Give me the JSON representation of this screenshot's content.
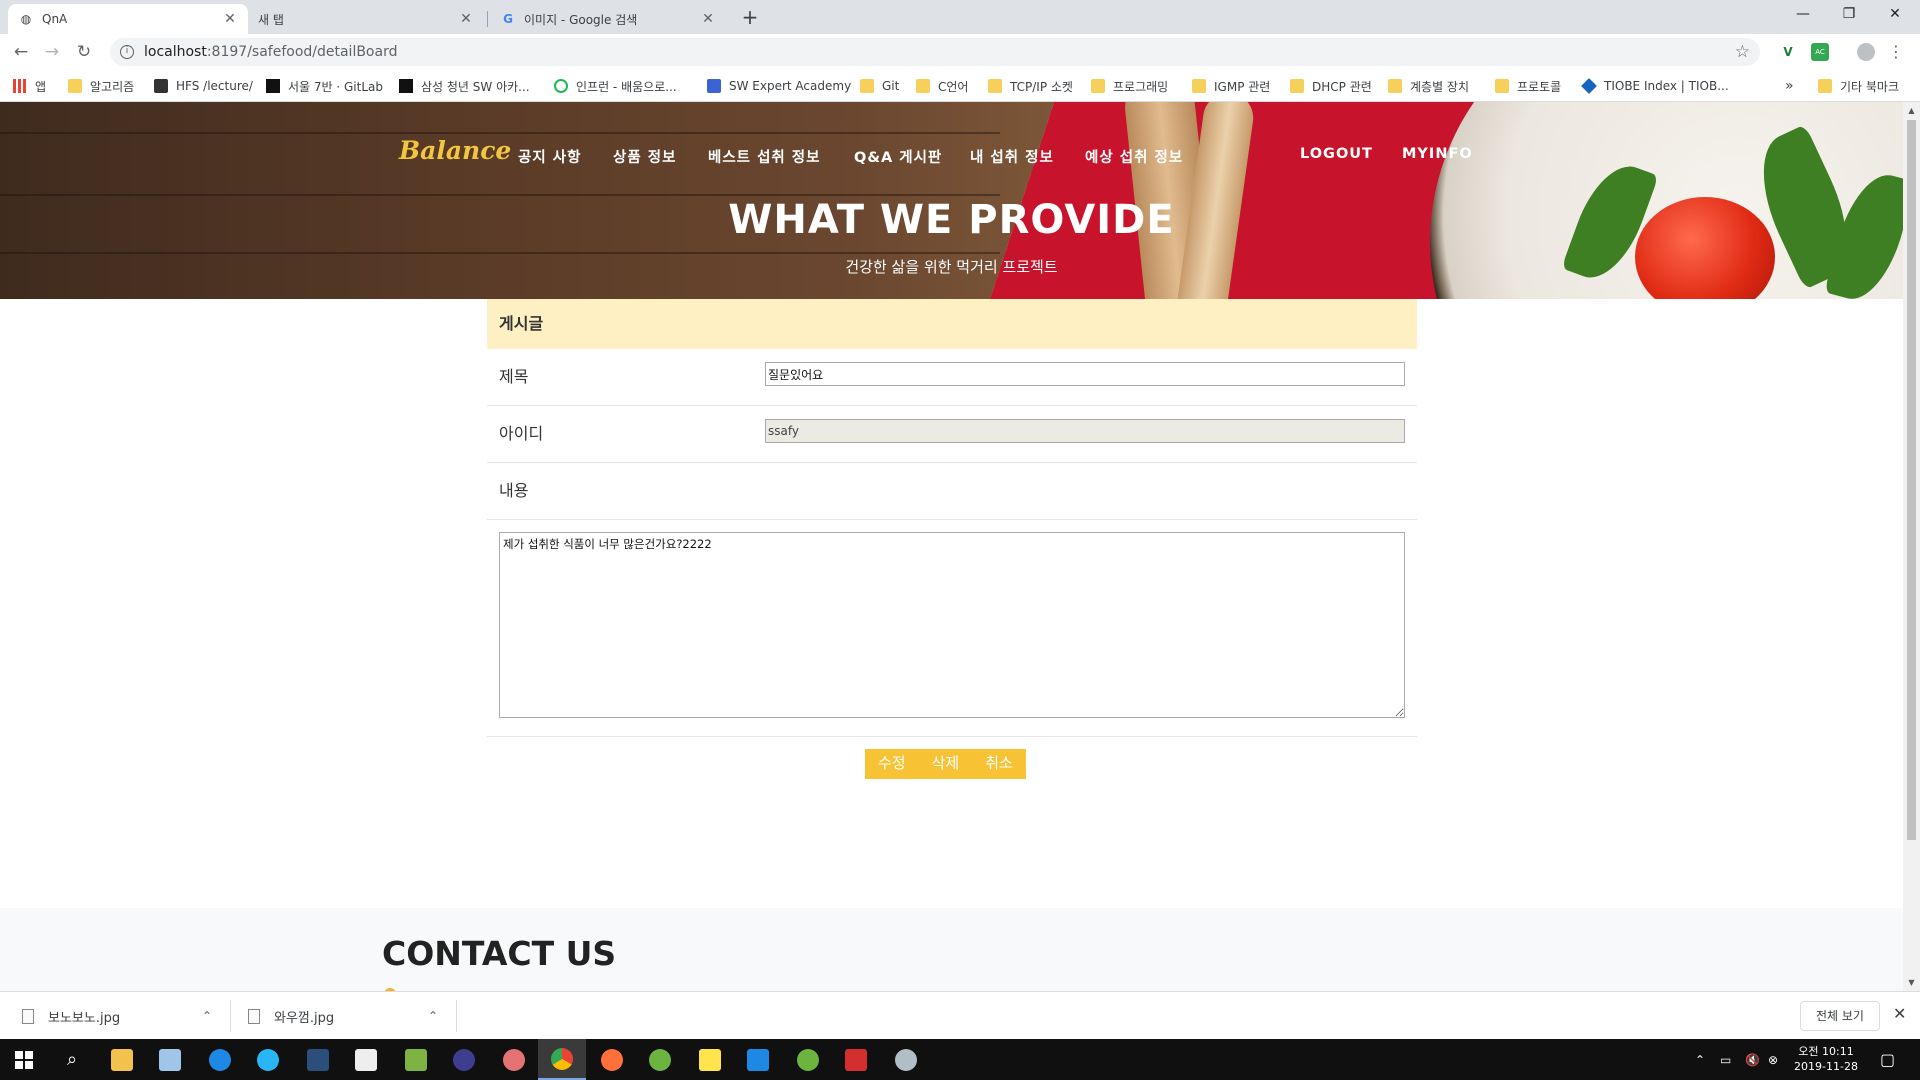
{
  "browser": {
    "tabs": [
      {
        "title": "QnA",
        "active": true
      },
      {
        "title": "새 탭",
        "active": false
      },
      {
        "title": "이미지 - Google 검색",
        "active": false
      }
    ],
    "url_host": "localhost",
    "url_path": ":8197/safefood/detailBoard",
    "bookmarks": [
      "앱",
      "알고리즘",
      "HFS /lecture/",
      "서울 7반 · GitLab",
      "삼성 청년 SW 아카...",
      "인프런 - 배움으로...",
      "SW Expert Academy",
      "Git",
      "C언어",
      "TCP/IP 소켓",
      "프로그래밍",
      "IGMP 관련",
      "DHCP 관련",
      "계층별 장치",
      "프로토콜",
      "TIOBE Index | TIOB..."
    ],
    "bookmarks_more": "»",
    "other_bookmarks": "기타 북마크"
  },
  "site": {
    "brand": "Balance",
    "nav": [
      "공지 사항",
      "상품 정보",
      "베스트 섭취 정보",
      "Q&A 게시판",
      "내 섭취 정보",
      "예상 섭취 정보",
      "LOGOUT",
      "MYINFO"
    ],
    "hero_title": "WHAT WE PROVIDE",
    "hero_subtitle": "건강한 삶을 위한 먹거리 프로젝트"
  },
  "board": {
    "heading": "게시글",
    "title_label": "제목",
    "title_value": "질문있어요",
    "id_label": "아이디",
    "id_value": "ssafy",
    "content_label": "내용",
    "content_value": "제가 섭취한 식품이 너무 많은건가요?2222",
    "buttons": [
      "수정",
      "삭제",
      "취소"
    ]
  },
  "contact": {
    "title": "CONTACT US"
  },
  "downloads": {
    "items": [
      "보노보노.jpg",
      "와우껌.jpg"
    ],
    "show_all": "전체 보기"
  },
  "taskbar": {
    "time": "오전 10:11",
    "date": "2019-11-28"
  },
  "colors": {
    "accent": "#f7c335",
    "board_header": "#fff0c4",
    "brand": "#f3c63f"
  }
}
